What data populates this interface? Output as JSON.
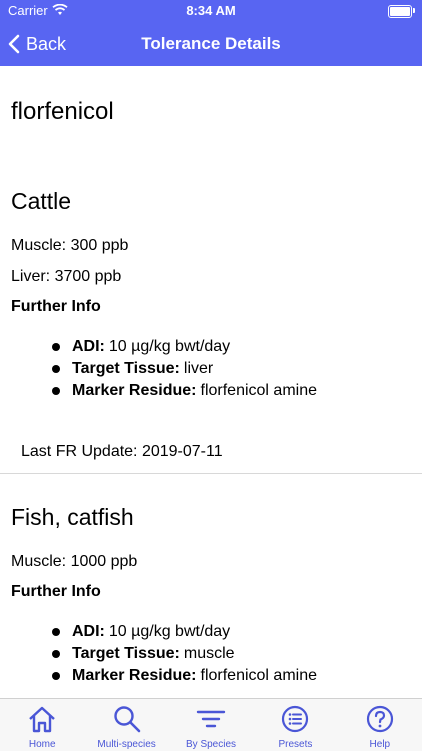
{
  "status": {
    "carrier": "Carrier",
    "time": "8:34 AM"
  },
  "nav": {
    "back_label": "Back",
    "title": "Tolerance Details"
  },
  "drug": "florfenicol",
  "sections": [
    {
      "species": "Cattle",
      "lines": [
        "Muscle:  300 ppb",
        "Liver:  3700 ppb"
      ],
      "further_info": "Further Info",
      "bullets": [
        {
          "key": "ADI:",
          "value": "10 µg/kg bwt/day"
        },
        {
          "key": "Target Tissue:",
          "value": "liver"
        },
        {
          "key": "Marker Residue:",
          "value": "florfenicol amine"
        }
      ],
      "update": "Last FR Update: 2019-07-11"
    },
    {
      "species": "Fish, catfish",
      "lines": [
        "Muscle:  1000 ppb"
      ],
      "further_info": "Further Info",
      "bullets": [
        {
          "key": "ADI:",
          "value": "10 µg/kg bwt/day"
        },
        {
          "key": "Target Tissue:",
          "value": "muscle"
        },
        {
          "key": "Marker Residue:",
          "value": "florfenicol amine"
        }
      ]
    }
  ],
  "tabs": [
    {
      "label": "Home",
      "icon": "home-icon"
    },
    {
      "label": "Multi-species",
      "icon": "search-icon"
    },
    {
      "label": "By Species",
      "icon": "filter-icon"
    },
    {
      "label": "Presets",
      "icon": "list-icon"
    },
    {
      "label": "Help",
      "icon": "help-icon"
    }
  ],
  "colors": {
    "accent": "#5865f2",
    "tab_tint": "#4a56d6"
  }
}
